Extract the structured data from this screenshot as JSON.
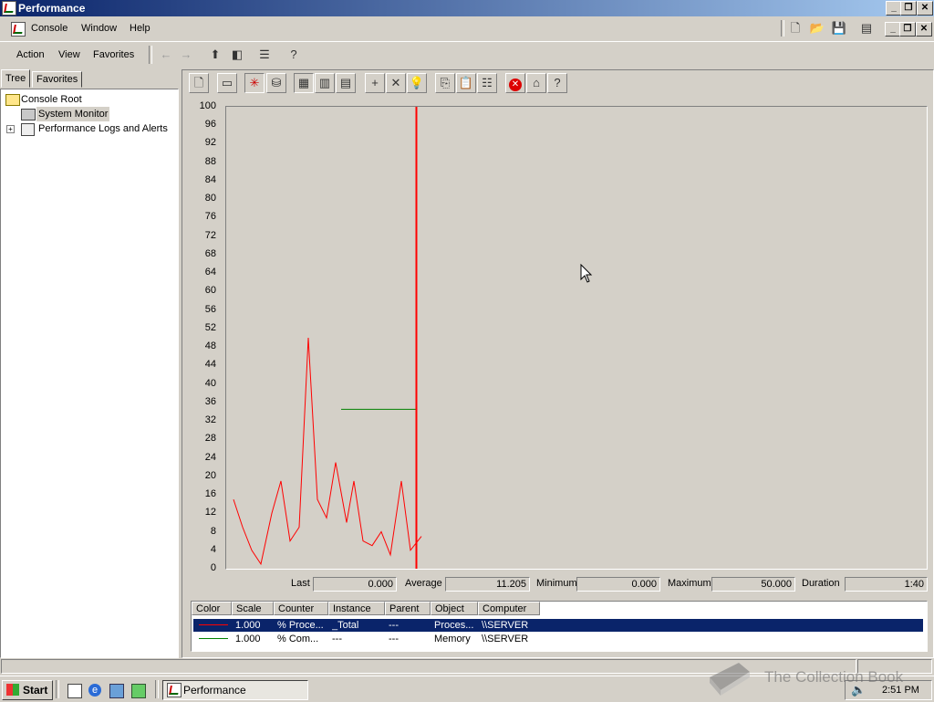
{
  "window": {
    "title": "Performance"
  },
  "menubar": {
    "items": [
      {
        "label": "Console",
        "icon": "app-icon"
      },
      {
        "label": "Window"
      },
      {
        "label": "Help"
      }
    ]
  },
  "actionbar": {
    "items": [
      {
        "label": "Action"
      },
      {
        "label": "View"
      },
      {
        "label": "Favorites"
      }
    ]
  },
  "tabs": [
    {
      "label": "Tree"
    },
    {
      "label": "Favorites"
    }
  ],
  "tree": {
    "items": [
      {
        "label": "Console Root",
        "icon": "folder-icon"
      },
      {
        "label": "System Monitor",
        "icon": "system-monitor-icon",
        "selected": true
      },
      {
        "label": "Performance Logs and Alerts",
        "icon": "performance-logs-icon",
        "expander": "+"
      }
    ]
  },
  "chart_data": {
    "type": "line",
    "ylim": [
      0,
      100
    ],
    "yticks": [
      "100",
      "96",
      "92",
      "88",
      "84",
      "80",
      "76",
      "72",
      "68",
      "64",
      "60",
      "56",
      "52",
      "48",
      "44",
      "40",
      "36",
      "32",
      "28",
      "24",
      "20",
      "16",
      "12",
      "8",
      "4",
      "0"
    ],
    "grid": false,
    "series": [
      {
        "color": "#ff0000",
        "x": [
          0,
          5,
          10,
          15,
          21,
          26,
          31,
          36,
          41,
          46,
          51,
          56,
          62,
          66,
          71,
          76,
          81,
          86,
          92,
          97,
          103
        ],
        "values": [
          15,
          9,
          4,
          1,
          12,
          19,
          6,
          9,
          50,
          15,
          11,
          23,
          10,
          19,
          6,
          5,
          8,
          3,
          19,
          4,
          7
        ]
      },
      {
        "color": "#008000",
        "x": [
          59,
          100
        ],
        "values": [
          34.5,
          34.5
        ]
      }
    ],
    "x_span": 100,
    "current_bar_color": "#ff0000"
  },
  "stats": {
    "last_label": "Last",
    "last_value": "0.000",
    "average_label": "Average",
    "average_value": "11.205",
    "minimum_label": "Minimum",
    "minimum_value": "0.000",
    "maximum_label": "Maximum",
    "maximum_value": "50.000",
    "duration_label": "Duration",
    "duration_value": "1:40"
  },
  "legend": {
    "headers": [
      "Color",
      "Scale",
      "Counter",
      "Instance",
      "Parent",
      "Object",
      "Computer"
    ],
    "rows": [
      {
        "color": "#ff0000",
        "scale": "1.000",
        "counter": "% Proce...",
        "instance": "_Total",
        "parent": "---",
        "object": "Proces...",
        "computer": "\\\\SERVER",
        "selected": true
      },
      {
        "color": "#008000",
        "scale": "1.000",
        "counter": "% Com...",
        "instance": "---",
        "parent": "---",
        "object": "Memory",
        "computer": "\\\\SERVER",
        "selected": false
      }
    ]
  },
  "taskbar": {
    "start_label": "Start",
    "task_label": "Performance",
    "clock": "2:51 PM"
  },
  "watermark": "The Collection Book",
  "colors": {
    "titlebar": "#0a246a",
    "selection": "#0a246a"
  }
}
